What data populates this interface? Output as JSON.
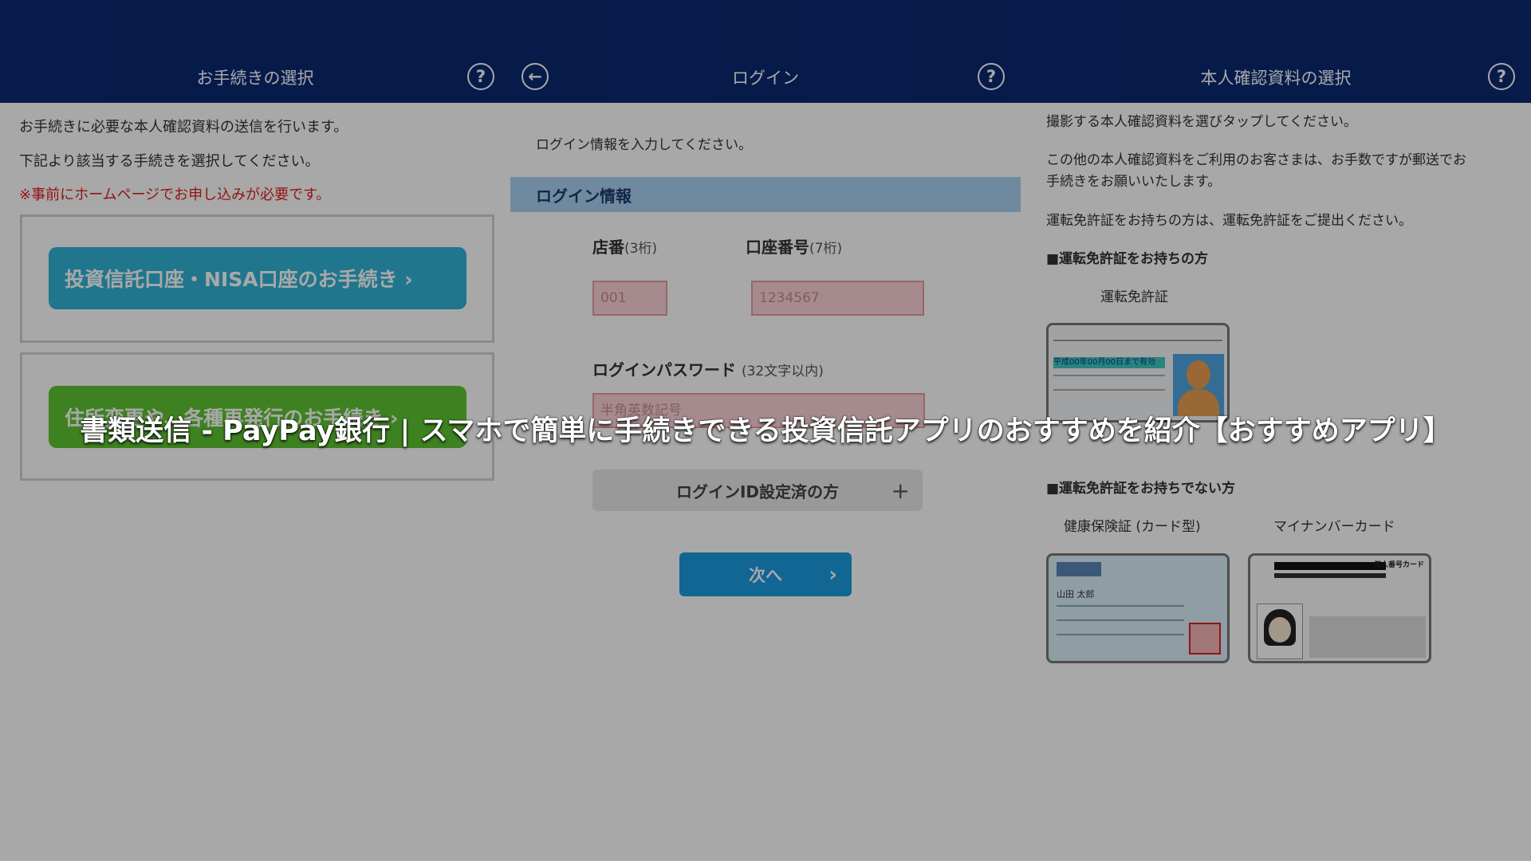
{
  "panel1": {
    "title": "お手続きの選択",
    "help": "?",
    "line1": "お手続きに必要な本人確認資料の送信を行います。",
    "line2": "下記より該当する手続きを選択してください。",
    "notice": "※事前にホームページでお申し込みが必要です。",
    "btn_invest": "投資信託口座・NISA口座のお手続き ›",
    "btn_address": "住所変更や、各種再発行のお手続き ›",
    "colors": {
      "teal": "#30b4d6",
      "green": "#5ec431",
      "notice": "#e0201c"
    }
  },
  "panel2": {
    "back": "←",
    "title": "ログイン",
    "help": "?",
    "intro": "ログイン情報を入力してください。",
    "section": "ログイン情報",
    "branch_label": "店番",
    "branch_hint": "(3桁)",
    "account_label": "口座番号",
    "account_hint": "(7桁)",
    "branch_placeholder": "001",
    "account_placeholder": "1234567",
    "password_label": "ログインパスワード",
    "password_hint": "(32文字以内)",
    "password_placeholder": "半角英数記号",
    "login_id": "ログインID設定済の方",
    "plus": "+",
    "next": "次へ",
    "next_chev": "›",
    "colors": {
      "section": "#a9d1f2",
      "next": "#1a9be0"
    }
  },
  "panel3": {
    "title": "本人確認資料の選択",
    "help": "?",
    "line1": "撮影する本人確認資料を選びタップしてください。",
    "line2": "この他の本人確認資料をご利用のお客さまは、お手数ですが郵送でお",
    "line3": "手続きをお願いいたします。",
    "line4": "運転免許証をお持ちの方は、運転免許証をご提出ください。",
    "heading_has": "■運転免許証をお持ちの方",
    "license": "運転免許証",
    "heading_not": "■運転免許証をお持ちでない方",
    "insurance": "健康保険証 (カード型)",
    "mynumber": "マイナンバーカード",
    "card_license_band": "平成00年00月00日まで有効",
    "card_insurance_name": "山田 太郎",
    "card_mynumber_title": "個人番号カード"
  },
  "caption": "書類送信 - PayPay銀行 | スマホで簡単に手続きできる投資信託アプリのおすすめを紹介【おすすめアプリ】",
  "header_color": "#0b2a73"
}
